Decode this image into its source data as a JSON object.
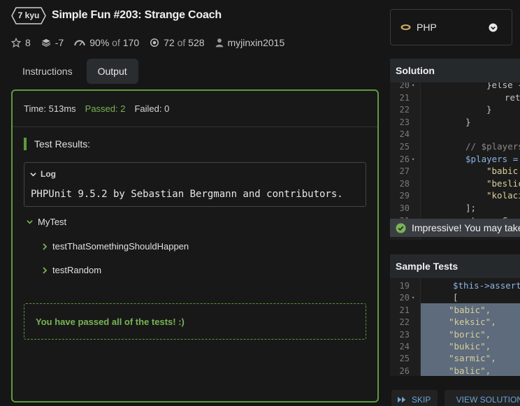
{
  "header": {
    "rank": "7 kyu",
    "title": "Simple Fun #203: Strange Coach",
    "stars": "8",
    "votes": "-7",
    "satisfaction_pct": "90%",
    "satisfaction_of": "of",
    "satisfaction_total": "170",
    "completed": "72",
    "completed_of": "of",
    "completed_total": "528",
    "author": "myjinxin2015"
  },
  "tabs": {
    "instructions": "Instructions",
    "output": "Output",
    "active": "Output"
  },
  "output": {
    "time": "Time: 513ms",
    "passed": "Passed: 2",
    "failed": "Failed: 0",
    "test_results": "Test Results:",
    "log_label": "Log",
    "log_text": "PHPUnit 9.5.2 by Sebastian Bergmann and contributors.",
    "suite": "MyTest",
    "tests": [
      "testThatSomethingShouldHappen",
      "testRandom"
    ],
    "success_message": "You have passed all of the tests! :)"
  },
  "language": {
    "selected": "PHP"
  },
  "solution": {
    "label": "Solution",
    "lines": [
      {
        "n": "20",
        "fold": true,
        "text": "}else {"
      },
      {
        "n": "21",
        "fold": false,
        "text": "ret"
      },
      {
        "n": "22",
        "fold": false,
        "text": "}"
      },
      {
        "n": "23",
        "fold": false,
        "text": "}"
      },
      {
        "n": "24",
        "fold": false,
        "text": ""
      },
      {
        "n": "25",
        "fold": false,
        "text": "// $players"
      },
      {
        "n": "26",
        "fold": true,
        "text": "$players = "
      },
      {
        "n": "27",
        "fold": false,
        "text": "\"babic"
      },
      {
        "n": "28",
        "fold": false,
        "text": "\"beslic"
      },
      {
        "n": "29",
        "fold": false,
        "text": "\"kolaci"
      },
      {
        "n": "30",
        "fold": false,
        "text": "];"
      },
      {
        "n": "31",
        "fold": false,
        "text": "strangeCoach"
      }
    ],
    "toast": "Impressive! You may take"
  },
  "sample_tests": {
    "label": "Sample Tests",
    "lines": [
      {
        "n": "19",
        "fold": false,
        "text": "$this->assertS"
      },
      {
        "n": "20",
        "fold": true,
        "text": "["
      },
      {
        "n": "21",
        "fold": false,
        "text": "\"babic\","
      },
      {
        "n": "22",
        "fold": false,
        "text": "\"keksic\","
      },
      {
        "n": "23",
        "fold": false,
        "text": "\"boric\","
      },
      {
        "n": "24",
        "fold": false,
        "text": "\"bukic\","
      },
      {
        "n": "25",
        "fold": false,
        "text": "\"sarmic\","
      },
      {
        "n": "26",
        "fold": false,
        "text": "\"balic\","
      }
    ]
  },
  "actions": {
    "skip": "SKIP",
    "view_solution": "VIEW SOLUTIONS"
  },
  "colors": {
    "accent_green": "#5e9a3c",
    "pass_text": "#79b455",
    "link_blue": "#6ea3d8"
  }
}
